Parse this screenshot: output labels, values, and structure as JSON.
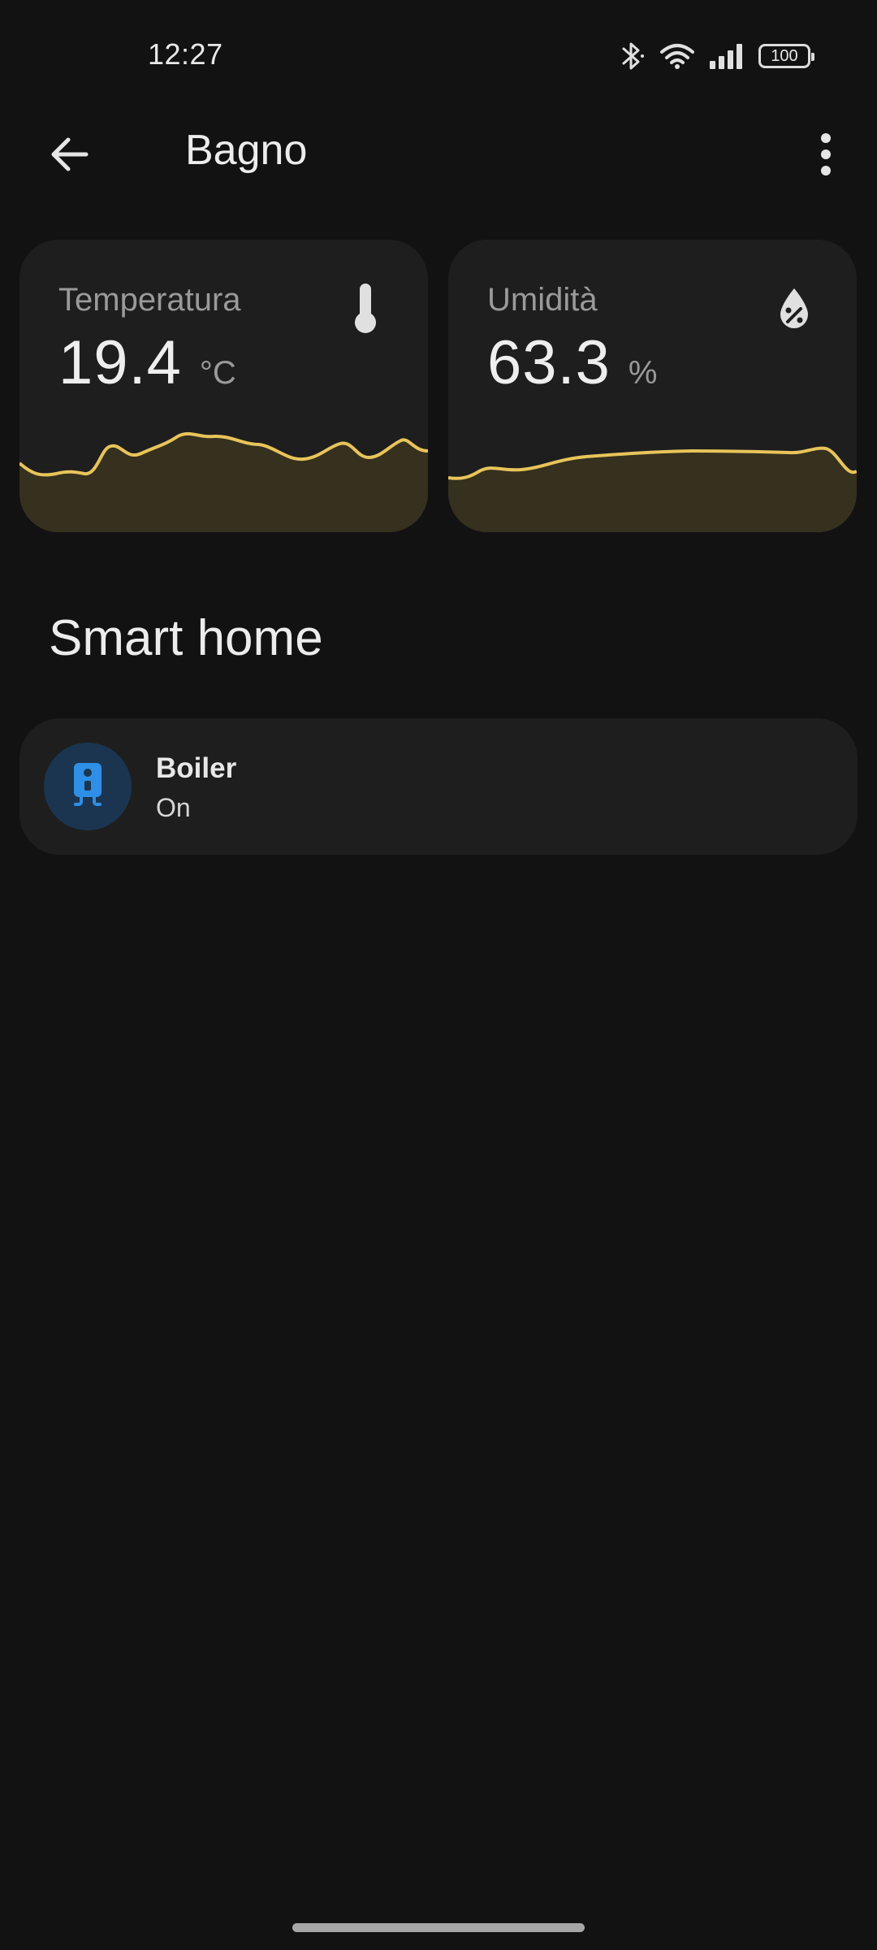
{
  "status_bar": {
    "time": "12:27",
    "battery": "100",
    "icons": [
      "bluetooth-icon",
      "wifi-icon",
      "signal-icon",
      "battery-icon"
    ]
  },
  "header": {
    "title": "Bagno",
    "back_icon": "arrow-left-icon",
    "menu_icon": "more-vertical-icon"
  },
  "sensors": [
    {
      "label": "Temperatura",
      "value": "19.4",
      "unit": "°C",
      "icon": "thermometer-icon"
    },
    {
      "label": "Umidità",
      "value": "63.3",
      "unit": "%",
      "icon": "water-percent-icon"
    }
  ],
  "colors": {
    "background": "#121212",
    "card": "#1e1e1e",
    "sparkline": "#e8c45a",
    "sparkline_fill": "#36301f",
    "device_icon_bg": "#1b3550",
    "device_icon": "#2f8fe6"
  },
  "smart_home": {
    "title": "Smart home",
    "devices": [
      {
        "name": "Boiler",
        "state": "On",
        "icon": "water-boiler-icon"
      }
    ]
  }
}
